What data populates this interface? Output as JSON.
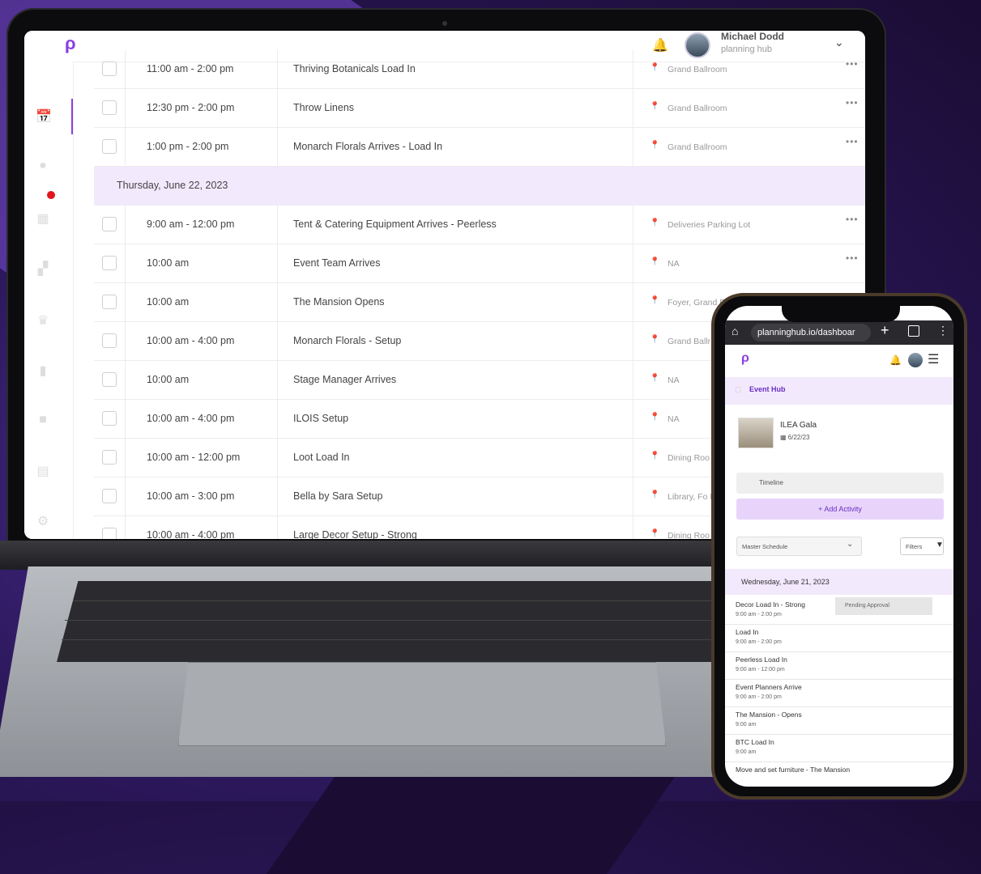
{
  "desktop": {
    "user": {
      "name": "Michael Dodd",
      "subtitle": "planning hub"
    },
    "rows": [
      {
        "time": "11:00 am  -  2:00 pm",
        "title": "Thriving Botanicals Load In",
        "location": "Grand Ballroom"
      },
      {
        "time": "12:30 pm  -  2:00 pm",
        "title": "Throw Linens",
        "location": "Grand Ballroom"
      },
      {
        "time": "1:00 pm  -  2:00 pm",
        "title": "Monarch Florals Arrives - Load In",
        "location": "Grand Ballroom"
      }
    ],
    "day_header": "Thursday, June 22, 2023",
    "rows2": [
      {
        "time": "9:00 am  -  12:00 pm",
        "title": "Tent & Catering Equipment Arrives - Peerless",
        "location": "Deliveries Parking Lot"
      },
      {
        "time": "10:00 am",
        "title": "Event Team Arrives",
        "location": "NA"
      },
      {
        "time": "10:00 am",
        "title": "The Mansion Opens",
        "location": "Foyer, Grand Ba"
      },
      {
        "time": "10:00 am  -  4:00 pm",
        "title": "Monarch Florals - Setup",
        "location": "Grand Ballr"
      },
      {
        "time": "10:00 am",
        "title": "Stage Manager Arrives",
        "location": "NA"
      },
      {
        "time": "10:00 am  -  4:00 pm",
        "title": "ILOIS Setup",
        "location": "NA"
      },
      {
        "time": "10:00 am  -  12:00 pm",
        "title": "Loot Load In",
        "location": "Dining Roo Ballroom"
      },
      {
        "time": "10:00 am  -  3:00 pm",
        "title": "Bella by Sara Setup",
        "location": "Library, Fo Parlour"
      },
      {
        "time": "10:00 am  -  4:00 pm",
        "title": "Large Decor Setup - Strong",
        "location": "Dining Roo"
      }
    ]
  },
  "mobile": {
    "url": "planninghub.io/dashboar",
    "nav_label": "Event Hub",
    "event": {
      "name": "ILEA Gala",
      "date": "6/22/23"
    },
    "timeline_label": "Timeline",
    "add_activity": "+ Add Activity",
    "schedule_select": "Master Schedule",
    "filters_label": "Filters",
    "day_header": "Wednesday, June 21, 2023",
    "pending_badge": "Pending Approval",
    "items": [
      {
        "title": "Decor Load In - Strong",
        "time": "9:00 am  -  2:00 pm"
      },
      {
        "title": "Load In",
        "time": "9:00 am  -  2:00 pm"
      },
      {
        "title": "Peerless Load In",
        "time": "9:00 am  -  12:00 pm"
      },
      {
        "title": "Event Planners Arrive",
        "time": "9:00 am  -  2:00 pm"
      },
      {
        "title": "The Mansion - Opens",
        "time": "9:00 am"
      },
      {
        "title": "BTC Load In",
        "time": "9:00 am"
      },
      {
        "title": "Move and set furniture - The Mansion",
        "time": ""
      }
    ]
  },
  "brand_color": "#8b3fe0"
}
